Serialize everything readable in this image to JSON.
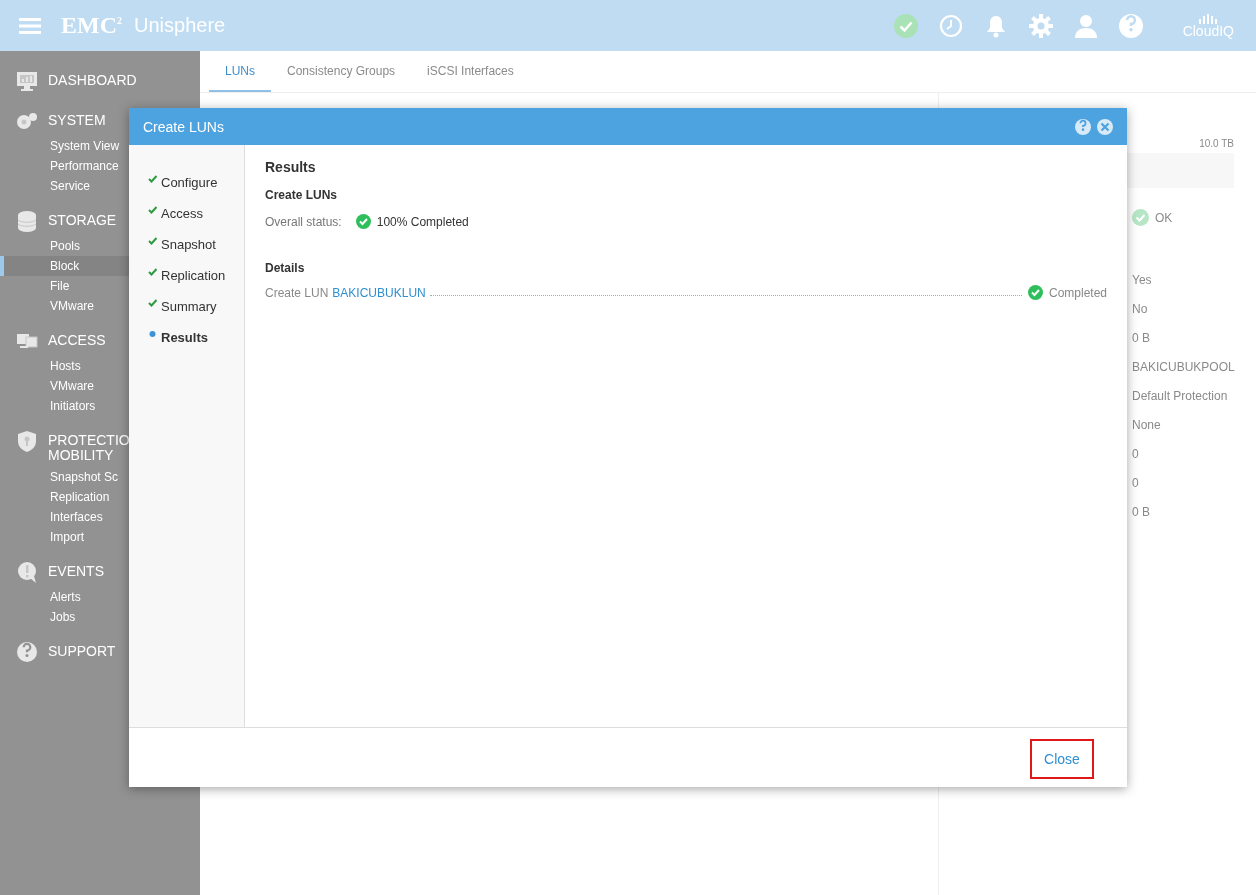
{
  "header": {
    "logo": "EMC$^{2}$",
    "app_name": "Unisphere",
    "cloud_label": "CloudIQ"
  },
  "sidebar": {
    "sections": [
      {
        "label_lines": [
          "DASHBOARD"
        ]
      },
      {
        "label_lines": [
          "SYSTEM"
        ],
        "items": [
          {
            "label": "System View",
            "selected": false
          },
          {
            "label": "Performance",
            "selected": false
          },
          {
            "label": "Service",
            "selected": false
          }
        ]
      },
      {
        "label_lines": [
          "STORAGE"
        ],
        "items": [
          {
            "label": "Pools",
            "selected": false
          },
          {
            "label": "Block",
            "selected": true
          },
          {
            "label": "File",
            "selected": false
          },
          {
            "label": "VMware",
            "selected": false
          }
        ]
      },
      {
        "label_lines": [
          "ACCESS"
        ],
        "items": [
          {
            "label": "Hosts",
            "selected": false
          },
          {
            "label": "VMware",
            "selected": false
          },
          {
            "label": "Initiators",
            "selected": false
          }
        ]
      },
      {
        "label_lines": [
          "PROTECTIO",
          "MOBILITY"
        ],
        "items": [
          {
            "label": "Snapshot Sc",
            "selected": false
          },
          {
            "label": "Replication",
            "selected": false
          },
          {
            "label": "Interfaces",
            "selected": false
          },
          {
            "label": "Import",
            "selected": false
          }
        ]
      },
      {
        "label_lines": [
          "EVENTS"
        ],
        "items": [
          {
            "label": "Alerts",
            "selected": false
          },
          {
            "label": "Jobs",
            "selected": false
          }
        ]
      },
      {
        "label_lines": [
          "SUPPORT"
        ]
      }
    ]
  },
  "tabs": [
    {
      "label": "LUNs",
      "selected": true
    },
    {
      "label": "Consistency Groups",
      "selected": false
    },
    {
      "label": "iSCSI Interfaces",
      "selected": false
    }
  ],
  "details_panel": {
    "capacity": "10.0 TB",
    "health": "OK",
    "values": [
      "Yes",
      "No",
      "0 B",
      "BAKICUBUKPOOL",
      "Default Protection",
      "None",
      "0",
      "0",
      "0 B"
    ]
  },
  "dialog": {
    "title": "Create LUNs",
    "steps": [
      {
        "label": "Configure",
        "completed": true,
        "selected": false
      },
      {
        "label": "Access",
        "completed": true,
        "selected": false
      },
      {
        "label": "Snapshot",
        "completed": true,
        "selected": false
      },
      {
        "label": "Replication",
        "completed": true,
        "selected": false
      },
      {
        "label": "Summary",
        "completed": true,
        "selected": false
      },
      {
        "label": "Results",
        "completed": false,
        "selected": true
      }
    ],
    "heading": "Results",
    "subheading": "Create LUNs",
    "status_label": "Overall status:",
    "status_value": "100% Completed",
    "details_heading": "Details",
    "tasks": [
      {
        "action": "Create LUN",
        "target": "BAKICUBUKLUN",
        "status": "Completed"
      }
    ],
    "close_button": "Close"
  }
}
